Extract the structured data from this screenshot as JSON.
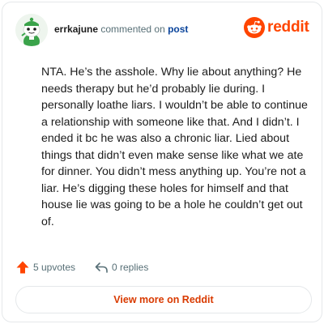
{
  "header": {
    "username": "errkajune",
    "action_text": " commented on ",
    "post_link": "post",
    "brand": "reddit",
    "brand_color": "#ff4500",
    "avatar_icon": "snoo-avatar-icon",
    "logo_icon": "reddit-alien-icon"
  },
  "comment": {
    "text": "NTA. He’s the asshole. Why lie about anything? He needs therapy but he’d probably lie during. I personally loathe liars. I wouldn’t be able to continue a relationship with someone like that. And I didn’t. I ended it bc he was also a chronic liar. Lied about things that didn’t even make sense like what we ate for dinner. You didn’t mess anything up. You’re not a liar. He’s digging these holes for himself and that house lie was going to be a hole he couldn’t get out of."
  },
  "footer": {
    "upvotes": "5 upvotes",
    "replies": "0 replies",
    "upvote_icon": "upvote-arrow-icon",
    "reply_icon": "reply-arrow-icon",
    "view_button": "View more on Reddit",
    "accent_color": "#d93a00"
  }
}
